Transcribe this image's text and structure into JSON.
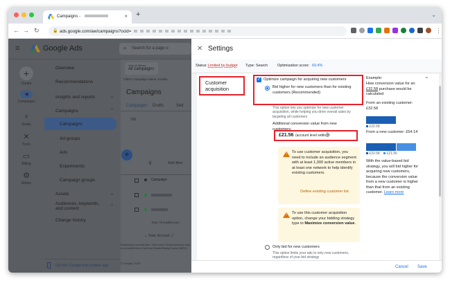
{
  "browser": {
    "tab_title": "Campaigns -",
    "url": "ads.google.com/aw/campaigns?ocid=",
    "new_tab": "+",
    "tab_menu": "⌄"
  },
  "app": {
    "brand": "Google Ads",
    "search_placeholder": "Search for a page o",
    "rail": [
      {
        "label": "Create",
        "icon": "plus-icon"
      },
      {
        "label": "Campaigns",
        "icon": "campaigns-icon"
      },
      {
        "label": "Goals",
        "icon": "trophy-icon"
      },
      {
        "label": "Tools",
        "icon": "tools-icon"
      },
      {
        "label": "Billing",
        "icon": "billing-icon"
      },
      {
        "label": "Admin",
        "icon": "gear-icon"
      }
    ],
    "nav": [
      {
        "label": "Overview"
      },
      {
        "label": "Recommendations"
      },
      {
        "label": "Insights and reports"
      },
      {
        "label": "Campaigns"
      },
      {
        "label": "Campaigns"
      },
      {
        "label": "Ad groups"
      },
      {
        "label": "Ads"
      },
      {
        "label": "Experiments"
      },
      {
        "label": "Campaign groups"
      },
      {
        "label": "Assets"
      },
      {
        "label": "Audiences, keywords, and content"
      },
      {
        "label": "Change history"
      }
    ],
    "mobile_app_link": "Get the Google Ads mobile app",
    "main": {
      "view_label": "View (2 filters)",
      "view_value": "All campaigns",
      "filters": "Filters  Campaign status: Enable",
      "title": "Campaigns",
      "tabs": [
        "Campaigns",
        "Drafts",
        "Sett"
      ],
      "add_filter": "Add filter",
      "col_campaign": "Campaign",
      "total_all": "Total: All enabled cam",
      "total_account": "Total: Account",
      "legal": "Reporting is not real-time. Time zone f Some inventory may be provided throu You'll see Media Rating Council (MRC)",
      "copyright": "© Google, 2023."
    }
  },
  "panel": {
    "title": "Settings",
    "status_label": "Status:",
    "status_value": "Limited by budget",
    "type_label": "Type:",
    "type_value": "Search",
    "opt_label": "Optimization score:",
    "opt_value": "69.4%",
    "section_title": "Customer acquisition",
    "checkbox_label": "Optimize campaign for acquiring new customers",
    "radio1_label": "Bid higher for new customers than for existing customers (Recommended)",
    "radio1_desc": "This option lets you optimize for new customer acquisition, while helping you drive overall sales by targeting all customers",
    "additional_label": "Additional conversion value from new customers:",
    "value_amount": "£21.56",
    "value_note": "(account level setting)",
    "warn1_text": "To use customer acquisition, you need to include an audience segment with at least 1,000 active members in at least one network to help identify existing customers.",
    "warn1_link": "Define existing customer list",
    "warn2_text": "To use this customer acquisition option, change your bidding strategy type to",
    "warn2_bold": "Maximize conversion value",
    "warn2_end": ".",
    "radio2_label": "Only bid for new customers",
    "radio2_desc": "This option limits your ads to only new customers, regardless of your bid strategy",
    "example": {
      "title": "Example:",
      "desc1": "How conversion value for an",
      "desc_amount": "£32.58",
      "desc2": "purchase would be calculated",
      "existing_label": "From an existing customer: £32.58",
      "bar1_label": "£32.58",
      "new_label": "From a new customer: £54.14",
      "bar2_label_a": "£32.58",
      "bar2_label_b": "£21.56",
      "explain": "With the value-based bid strategy, you will bid higher for acquiring new customers, because the conversion value from a new customer is higher than that from an existing customer.",
      "learn_more": "Learn more",
      "existing_value": 32.58,
      "new_extra_value": 21.56
    },
    "cancel": "Cancel",
    "save": "Save"
  },
  "colors": {
    "accent": "#1a73e8",
    "highlight": "#e8202a",
    "warning": "#e37400",
    "bar_dark": "#1a5fb4",
    "bar_light": "#4a90e2"
  }
}
